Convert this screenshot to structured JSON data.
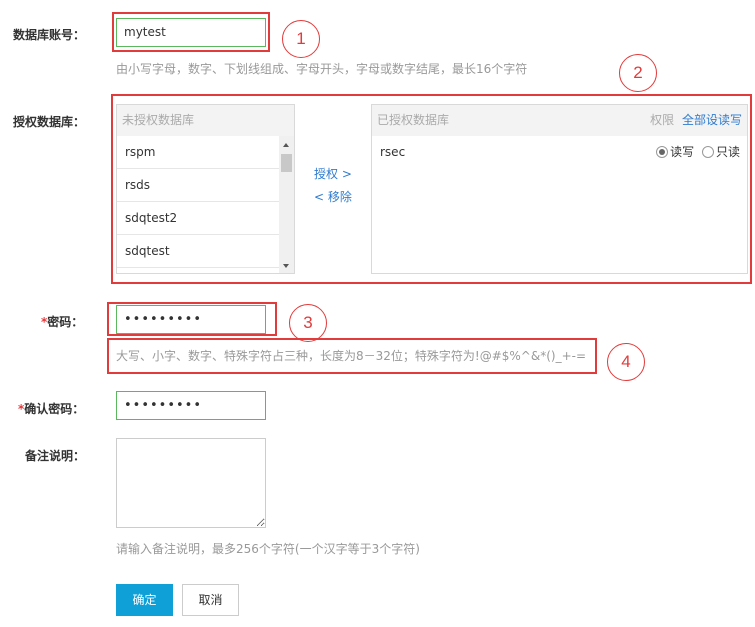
{
  "form": {
    "account": {
      "label": "数据库账号：",
      "value": "mytest",
      "hint": "由小写字母，数字、下划线组成、字母开头，字母或数字结尾，最长16个字符"
    },
    "auth": {
      "label": "授权数据库：",
      "unauthorized": {
        "title": "未授权数据库",
        "items": [
          "rspm",
          "rsds",
          "sdqtest2",
          "sdqtest"
        ]
      },
      "grant_label": "授权 >",
      "remove_label": "< 移除",
      "authorized": {
        "title": "已授权数据库",
        "perm_label": "权限",
        "set_all_label": "全部设读写",
        "items": [
          {
            "name": "rsec",
            "rw_label": "读写",
            "ro_label": "只读",
            "selected": "rw"
          }
        ]
      }
    },
    "password": {
      "required_mark": "*",
      "label": "密码：",
      "value": "•••••••••",
      "hint": "大写、小字、数字、特殊字符占三种，长度为8－32位；特殊字符为!@#$%^&*()_+-="
    },
    "confirm": {
      "required_mark": "*",
      "label": "确认密码：",
      "value": "•••••••••"
    },
    "remark": {
      "label": "备注说明：",
      "value": "",
      "hint": "请输入备注说明，最多256个字符(一个汉字等于3个字符)"
    },
    "ok_label": "确定",
    "cancel_label": "取消"
  },
  "annotations": [
    "1",
    "2",
    "3",
    "4"
  ],
  "colors": {
    "annotation": "#e23b3b",
    "primary_button": "#0fa0d8",
    "link": "#2f7bd0",
    "input_border": "#5cb85c"
  }
}
